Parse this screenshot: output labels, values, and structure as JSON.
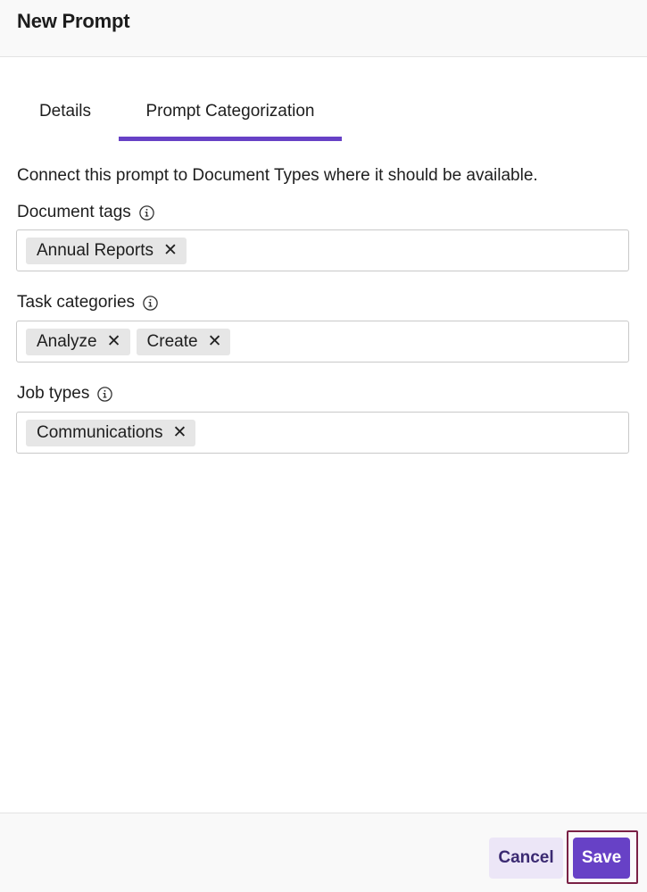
{
  "header": {
    "title": "New Prompt"
  },
  "tabs": [
    {
      "label": "Details",
      "active": false
    },
    {
      "label": "Prompt Categorization",
      "active": true
    }
  ],
  "intro": "Connect this prompt to Document Types where it should be available.",
  "fields": {
    "document_tags": {
      "label": "Document tags",
      "tags": [
        "Annual Reports"
      ]
    },
    "task_categories": {
      "label": "Task categories",
      "tags": [
        "Analyze",
        "Create"
      ]
    },
    "job_types": {
      "label": "Job types",
      "tags": [
        "Communications"
      ]
    }
  },
  "chip_remove_glyph": "✕",
  "footer": {
    "cancel_label": "Cancel",
    "save_label": "Save"
  },
  "colors": {
    "accent": "#6741c6",
    "focus_outline": "#7a2145",
    "cancel_bg": "#ece6f7"
  },
  "icons": {
    "field_info": "info-icon",
    "chip_remove": "close-icon"
  }
}
